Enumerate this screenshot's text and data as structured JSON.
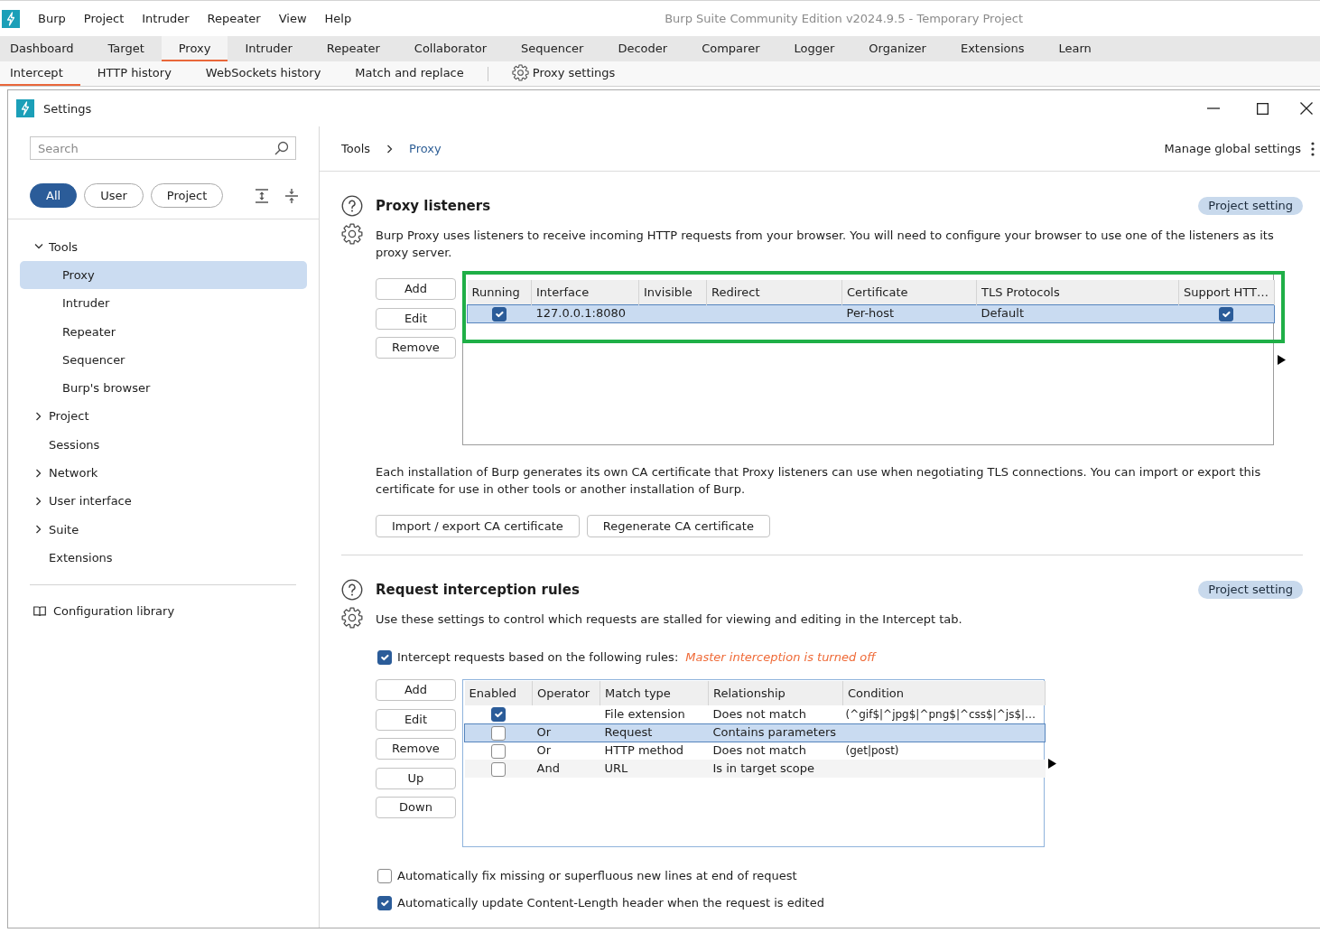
{
  "app": {
    "title": "Burp Suite Community Edition v2024.9.5 - Temporary Project",
    "menu": [
      "Burp",
      "Project",
      "Intruder",
      "Repeater",
      "View",
      "Help"
    ],
    "tabs": [
      {
        "label": "Dashboard",
        "selected": false
      },
      {
        "label": "Target",
        "selected": false
      },
      {
        "label": "Proxy",
        "selected": true
      },
      {
        "label": "Intruder",
        "selected": false
      },
      {
        "label": "Repeater",
        "selected": false
      },
      {
        "label": "Collaborator",
        "selected": false
      },
      {
        "label": "Sequencer",
        "selected": false
      },
      {
        "label": "Decoder",
        "selected": false
      },
      {
        "label": "Comparer",
        "selected": false
      },
      {
        "label": "Logger",
        "selected": false
      },
      {
        "label": "Organizer",
        "selected": false
      },
      {
        "label": "Extensions",
        "selected": false
      },
      {
        "label": "Learn",
        "selected": false
      }
    ],
    "subtabs": [
      {
        "label": "Intercept",
        "kind": "tab",
        "selected": true
      },
      {
        "label": "HTTP history",
        "kind": "tab",
        "selected": false
      },
      {
        "label": "WebSockets history",
        "kind": "tab",
        "selected": false
      },
      {
        "label": "Match and replace",
        "kind": "tab",
        "selected": false
      },
      {
        "label": "Proxy settings",
        "kind": "settings",
        "selected": false
      }
    ]
  },
  "settings": {
    "title": "Settings",
    "search": {
      "placeholder": "Search"
    },
    "filters": [
      {
        "label": "All",
        "selected": true
      },
      {
        "label": "User",
        "selected": false
      },
      {
        "label": "Project",
        "selected": false
      }
    ],
    "tree": [
      {
        "label": "Tools",
        "kind": "group",
        "expanded": true,
        "selected": false,
        "children": [
          {
            "label": "Proxy",
            "kind": "page",
            "selected": true
          },
          {
            "label": "Intruder",
            "kind": "page",
            "selected": false
          },
          {
            "label": "Repeater",
            "kind": "page",
            "selected": false
          },
          {
            "label": "Sequencer",
            "kind": "page",
            "selected": false
          },
          {
            "label": "Burp's browser",
            "kind": "page",
            "selected": false
          }
        ]
      },
      {
        "label": "Project",
        "kind": "group",
        "expanded": false,
        "selected": false
      },
      {
        "label": "Sessions",
        "kind": "page",
        "selected": false
      },
      {
        "label": "Network",
        "kind": "group",
        "expanded": false,
        "selected": false
      },
      {
        "label": "User interface",
        "kind": "group",
        "expanded": false,
        "selected": false
      },
      {
        "label": "Suite",
        "kind": "group",
        "expanded": false,
        "selected": false
      },
      {
        "label": "Extensions",
        "kind": "page",
        "selected": false
      }
    ],
    "library_link": "Configuration library",
    "breadcrumb": [
      "Tools",
      "Proxy"
    ],
    "manage_link": "Manage global settings",
    "proxy_listeners": {
      "title": "Proxy listeners",
      "badge": "Project setting",
      "description": "Burp Proxy uses listeners to receive incoming HTTP requests from your browser. You will need to configure your browser to use one of the listeners as its proxy server.",
      "buttons": [
        "Add",
        "Edit",
        "Remove"
      ],
      "table": {
        "highlighted": true,
        "columns": [
          "Running",
          "Interface",
          "Invisible",
          "Redirect",
          "Certificate",
          "TLS Protocols",
          "Support HTT…"
        ],
        "rows": [
          {
            "selected": true,
            "running": true,
            "interface": "127.0.0.1:8080",
            "certificate": "Per-host",
            "tls_protocols": "Default",
            "column_7": true
          }
        ]
      },
      "ca_note": "Each installation of Burp generates its own CA certificate that Proxy listeners can use when negotiating TLS connections. You can import or export this certificate for use in other tools or another installation of Burp.",
      "ca_buttons": [
        "Import / export CA certificate",
        "Regenerate CA certificate"
      ]
    },
    "interception_rules": {
      "title": "Request interception rules",
      "badge": "Project setting",
      "description": "Use these settings to control which requests are stalled for viewing and editing in the Intercept tab.",
      "enable_rules": {
        "label": "Intercept requests based on the following rules:",
        "checked": true,
        "note": "Master interception is turned off"
      },
      "buttons": [
        "Add",
        "Edit",
        "Remove",
        "Up",
        "Down"
      ],
      "table": {
        "columns": [
          "Enabled",
          "Operator",
          "Match type",
          "Relationship",
          "Condition"
        ],
        "rows": [
          {
            "selected": false,
            "enabled": true,
            "match_type": "File extension",
            "relationship": "Does not match",
            "condition": "(^gif$|^jpg$|^png$|^css$|^js$|…"
          },
          {
            "selected": true,
            "enabled": false,
            "operator": "Or",
            "match_type": "Request",
            "relationship": "Contains parameters"
          },
          {
            "selected": false,
            "enabled": false,
            "operator": "Or",
            "match_type": "HTTP method",
            "relationship": "Does not match",
            "condition": "(get|post)"
          },
          {
            "selected": false,
            "enabled": false,
            "operator": "And",
            "match_type": "URL",
            "relationship": "Is in target scope"
          }
        ]
      },
      "options": [
        {
          "label": "Automatically fix missing or superfluous new lines at end of request",
          "checked": false
        },
        {
          "label": "Automatically update Content-Length header when the request is edited",
          "checked": true
        }
      ]
    }
  }
}
